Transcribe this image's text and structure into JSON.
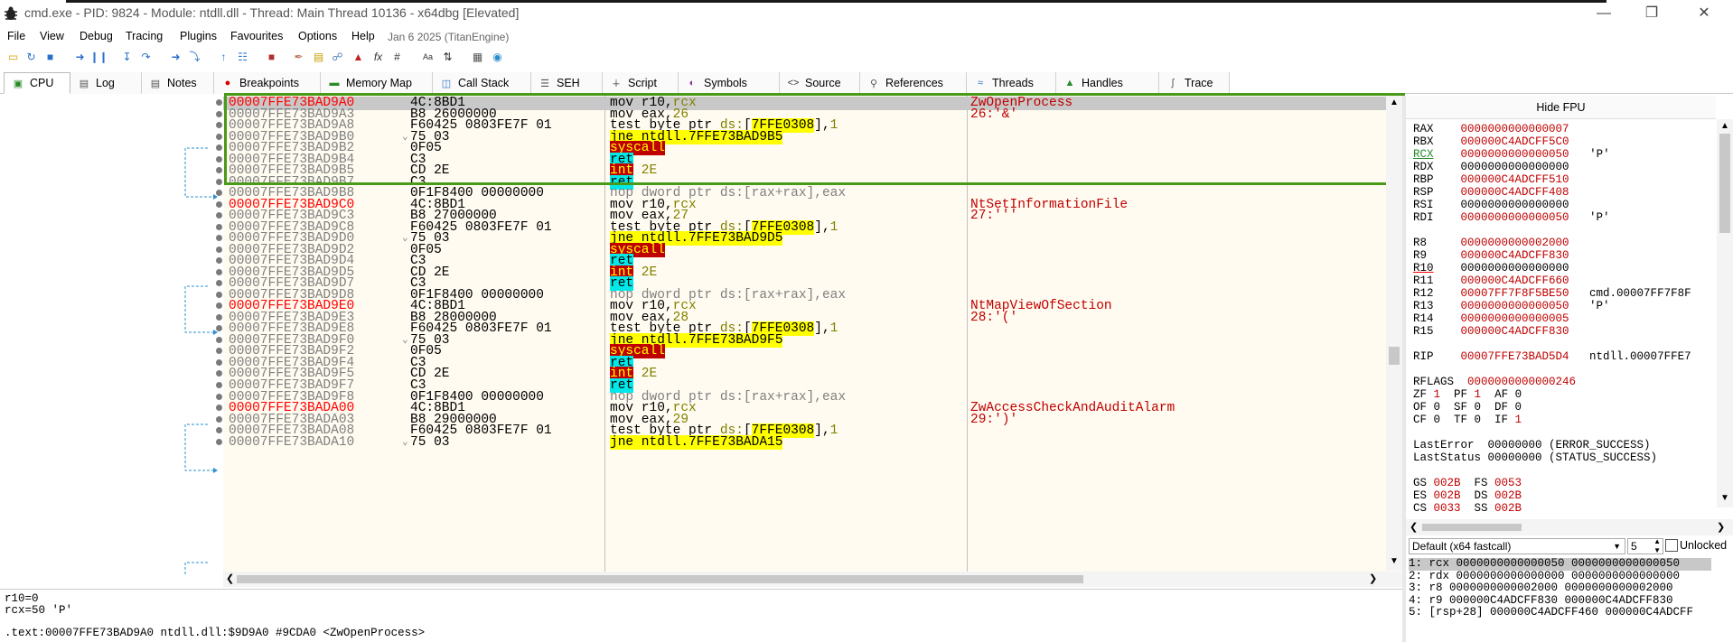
{
  "window": {
    "title": "cmd.exe - PID: 9824 - Module: ntdll.dll - Thread: Main Thread 10136 - x64dbg [Elevated]"
  },
  "menu": {
    "items": [
      "File",
      "View",
      "Debug",
      "Tracing",
      "Plugins",
      "Favourites",
      "Options",
      "Help"
    ],
    "date": "Jan 6 2025 (TitanEngine)"
  },
  "tabs": [
    {
      "label": "CPU",
      "icon": "cpu-icon"
    },
    {
      "label": "Log",
      "icon": "log-icon"
    },
    {
      "label": "Notes",
      "icon": "notes-icon"
    },
    {
      "label": "Breakpoints",
      "icon": "breakpoint-icon"
    },
    {
      "label": "Memory Map",
      "icon": "memory-map-icon"
    },
    {
      "label": "Call Stack",
      "icon": "call-stack-icon"
    },
    {
      "label": "SEH",
      "icon": "seh-icon"
    },
    {
      "label": "Script",
      "icon": "script-icon"
    },
    {
      "label": "Symbols",
      "icon": "symbols-icon"
    },
    {
      "label": "Source",
      "icon": "source-icon"
    },
    {
      "label": "References",
      "icon": "references-icon"
    },
    {
      "label": "Threads",
      "icon": "threads-icon"
    },
    {
      "label": "Handles",
      "icon": "handles-icon"
    },
    {
      "label": "Trace",
      "icon": "trace-icon"
    }
  ],
  "disasm": [
    {
      "addr": "00007FFE73BAD9A0",
      "lbl": true,
      "bytes": "4C:8BD1",
      "instr": "mov r10,rcx",
      "comment": "ZwOpenProcess",
      "sel": true
    },
    {
      "addr": "00007FFE73BAD9A3",
      "bytes": "B8 26000000",
      "instr": "mov eax,26",
      "comment": "26:'&'"
    },
    {
      "addr": "00007FFE73BAD9A8",
      "bytes": "F60425 0803FE7F 01",
      "instr": "test byte ptr ds:[7FFE0308],1",
      "comment": ""
    },
    {
      "addr": "00007FFE73BAD9B0",
      "bytes": "75 03",
      "instr": "jne ntdll.7FFE73BAD9B5",
      "comment": "",
      "jmp": true
    },
    {
      "addr": "00007FFE73BAD9B2",
      "bytes": "0F05",
      "instr": "syscall",
      "comment": ""
    },
    {
      "addr": "00007FFE73BAD9B4",
      "bytes": "C3",
      "instr": "ret",
      "comment": ""
    },
    {
      "addr": "00007FFE73BAD9B5",
      "bytes": "CD 2E",
      "instr": "int 2E",
      "comment": ""
    },
    {
      "addr": "00007FFE73BAD9B7",
      "bytes": "C3",
      "instr": "ret",
      "comment": ""
    },
    {
      "addr": "00007FFE73BAD9B8",
      "bytes": "0F1F8400 00000000",
      "instr": "nop dword ptr ds:[rax+rax],eax",
      "comment": ""
    },
    {
      "addr": "00007FFE73BAD9C0",
      "lbl": true,
      "bytes": "4C:8BD1",
      "instr": "mov r10,rcx",
      "comment": "NtSetInformationFile"
    },
    {
      "addr": "00007FFE73BAD9C3",
      "bytes": "B8 27000000",
      "instr": "mov eax,27",
      "comment": "27:'''"
    },
    {
      "addr": "00007FFE73BAD9C8",
      "bytes": "F60425 0803FE7F 01",
      "instr": "test byte ptr ds:[7FFE0308],1",
      "comment": ""
    },
    {
      "addr": "00007FFE73BAD9D0",
      "bytes": "75 03",
      "instr": "jne ntdll.7FFE73BAD9D5",
      "comment": "",
      "jmp": true
    },
    {
      "addr": "00007FFE73BAD9D2",
      "bytes": "0F05",
      "instr": "syscall",
      "comment": ""
    },
    {
      "addr": "00007FFE73BAD9D4",
      "bytes": "C3",
      "instr": "ret",
      "comment": ""
    },
    {
      "addr": "00007FFE73BAD9D5",
      "bytes": "CD 2E",
      "instr": "int 2E",
      "comment": ""
    },
    {
      "addr": "00007FFE73BAD9D7",
      "bytes": "C3",
      "instr": "ret",
      "comment": ""
    },
    {
      "addr": "00007FFE73BAD9D8",
      "bytes": "0F1F8400 00000000",
      "instr": "nop dword ptr ds:[rax+rax],eax",
      "comment": ""
    },
    {
      "addr": "00007FFE73BAD9E0",
      "lbl": true,
      "bytes": "4C:8BD1",
      "instr": "mov r10,rcx",
      "comment": "NtMapViewOfSection"
    },
    {
      "addr": "00007FFE73BAD9E3",
      "bytes": "B8 28000000",
      "instr": "mov eax,28",
      "comment": "28:'('"
    },
    {
      "addr": "00007FFE73BAD9E8",
      "bytes": "F60425 0803FE7F 01",
      "instr": "test byte ptr ds:[7FFE0308],1",
      "comment": ""
    },
    {
      "addr": "00007FFE73BAD9F0",
      "bytes": "75 03",
      "instr": "jne ntdll.7FFE73BAD9F5",
      "comment": "",
      "jmp": true
    },
    {
      "addr": "00007FFE73BAD9F2",
      "bytes": "0F05",
      "instr": "syscall",
      "comment": ""
    },
    {
      "addr": "00007FFE73BAD9F4",
      "bytes": "C3",
      "instr": "ret",
      "comment": ""
    },
    {
      "addr": "00007FFE73BAD9F5",
      "bytes": "CD 2E",
      "instr": "int 2E",
      "comment": ""
    },
    {
      "addr": "00007FFE73BAD9F7",
      "bytes": "C3",
      "instr": "ret",
      "comment": ""
    },
    {
      "addr": "00007FFE73BAD9F8",
      "bytes": "0F1F8400 00000000",
      "instr": "nop dword ptr ds:[rax+rax],eax",
      "comment": ""
    },
    {
      "addr": "00007FFE73BADA00",
      "lbl": true,
      "bytes": "4C:8BD1",
      "instr": "mov r10,rcx",
      "comment": "ZwAccessCheckAndAuditAlarm"
    },
    {
      "addr": "00007FFE73BADA03",
      "bytes": "B8 29000000",
      "instr": "mov eax,29",
      "comment": "29:')'"
    },
    {
      "addr": "00007FFE73BADA08",
      "bytes": "F60425 0803FE7F 01",
      "instr": "test byte ptr ds:[7FFE0308],1",
      "comment": ""
    },
    {
      "addr": "00007FFE73BADA10",
      "bytes": "75 03",
      "instr": "jne ntdll.7FFE73BADA15",
      "comment": "",
      "jmp": true
    }
  ],
  "registers": {
    "hide_fpu": "Hide FPU",
    "gp": [
      {
        "n": "RAX",
        "v": "0000000000000007",
        "c": ""
      },
      {
        "n": "RBX",
        "v": "000000C4ADCFF5C0",
        "c": ""
      },
      {
        "n": "RCX",
        "v": "0000000000000050",
        "c": "'P'"
      },
      {
        "n": "RDX",
        "v": "0000000000000000",
        "c": ""
      },
      {
        "n": "RBP",
        "v": "000000C4ADCFF510",
        "c": ""
      },
      {
        "n": "RSP",
        "v": "000000C4ADCFF408",
        "c": ""
      },
      {
        "n": "RSI",
        "v": "0000000000000000",
        "c": ""
      },
      {
        "n": "RDI",
        "v": "0000000000000050",
        "c": "'P'"
      },
      {
        "n": "R8",
        "v": "0000000000002000",
        "c": ""
      },
      {
        "n": "R9",
        "v": "000000C4ADCFF830",
        "c": ""
      },
      {
        "n": "R10",
        "v": "0000000000000000",
        "c": ""
      },
      {
        "n": "R11",
        "v": "000000C4ADCFF660",
        "c": ""
      },
      {
        "n": "R12",
        "v": "00007FF7F8F5BE50",
        "c": "cmd.00007FF7F8F"
      },
      {
        "n": "R13",
        "v": "0000000000000050",
        "c": "'P'"
      },
      {
        "n": "R14",
        "v": "0000000000000005",
        "c": ""
      },
      {
        "n": "R15",
        "v": "000000C4ADCFF830",
        "c": ""
      }
    ],
    "rip": {
      "n": "RIP",
      "v": "00007FFE73BAD5D4",
      "c": "ntdll.00007FFE7"
    },
    "rflags": {
      "n": "RFLAGS",
      "v": "0000000000000246"
    },
    "flags": [
      "ZF 1  PF 1  AF 0",
      "OF 0  SF 0  DF 0",
      "CF 0  TF 0  IF 1"
    ],
    "last_error": "LastError  00000000 (ERROR_SUCCESS)",
    "last_status": "LastStatus 00000000 (STATUS_SUCCESS)",
    "segs": [
      "GS 002B  FS 0053",
      "ES 002B  DS 002B",
      "CS 0033  SS 002B"
    ]
  },
  "callconv": {
    "selected": "Default (x64 fastcall)",
    "count": "5",
    "unlocked_label": "Unlocked"
  },
  "stack_args": [
    "1: rcx 0000000000000050 0000000000000050",
    "2: rdx 0000000000000000 0000000000000000",
    "3: r8 0000000000002000 0000000000002000",
    "4: r9 000000C4ADCFF830 000000C4ADCFF830",
    "5: [rsp+28] 000000C4ADCFF460 000000C4ADCFF"
  ],
  "log": {
    "line1": "r10=0",
    "line2": "rcx=50 'P'",
    "line3": ".text:00007FFE73BAD9A0 ntdll.dll:$9D9A0 #9CDA0 <ZwOpenProcess>"
  }
}
